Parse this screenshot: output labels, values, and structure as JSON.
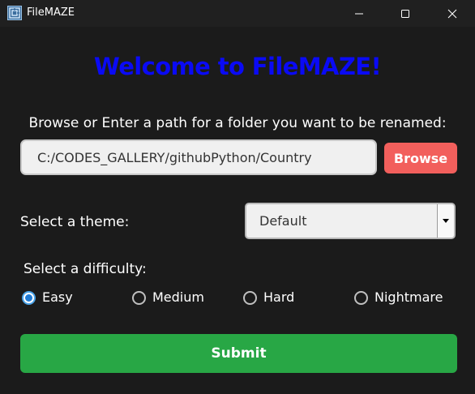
{
  "window": {
    "title": "FileMAZE",
    "icon": "app-maze-icon",
    "controls": [
      "minimize-icon",
      "maximize-icon",
      "close-icon"
    ]
  },
  "main": {
    "welcome": "Welcome to FileMAZE!",
    "browse_label": "Browse or Enter a path for a folder you want to be renamed:",
    "path_value": "C:/CODES_GALLERY/githubPython/Country",
    "browse_button": "Browse",
    "theme_label": "Select a theme:",
    "theme_selected": "Default",
    "difficulty_label": "Select a difficulty:",
    "difficulties": [
      {
        "label": "Easy",
        "checked": true
      },
      {
        "label": "Medium",
        "checked": false
      },
      {
        "label": "Hard",
        "checked": false
      },
      {
        "label": "Nightmare",
        "checked": false
      }
    ],
    "submit_button": "Submit"
  },
  "colors": {
    "background": "#1b1b1b",
    "welcome_text": "#0a0af5",
    "browse_button": "#f25f5c",
    "submit_button": "#28a745",
    "radio_accent": "#1f7ad4"
  }
}
